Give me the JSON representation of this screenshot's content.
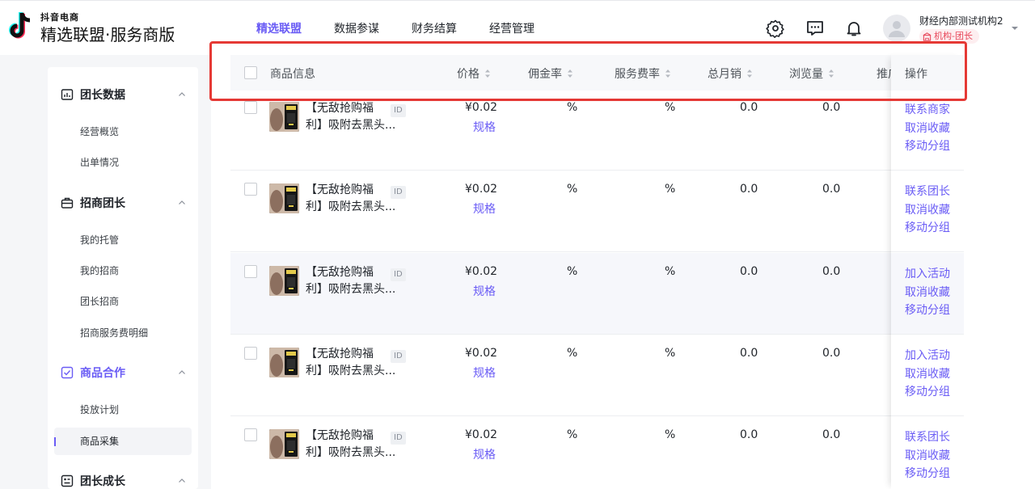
{
  "brand": {
    "small": "抖音电商",
    "main": "精选联盟·服务商版"
  },
  "nav": {
    "items": [
      "精选联盟",
      "数据参谋",
      "财务结算",
      "经营管理"
    ],
    "active_index": 0
  },
  "account": {
    "name": "财经内部测试机构2",
    "role": "机构-团长"
  },
  "sidebar": {
    "sections": [
      {
        "title": "团长数据",
        "icon": "chart-icon",
        "items": [
          "经营概览",
          "出单情况"
        ]
      },
      {
        "title": "招商团长",
        "icon": "briefcase-icon",
        "items": [
          "我的托管",
          "我的招商",
          "团长招商",
          "招商服务费明细"
        ]
      },
      {
        "title": "商品合作",
        "icon": "checkbox-icon",
        "items": [
          "投放计划",
          "商品采集"
        ]
      },
      {
        "title": "团长成长",
        "icon": "growth-icon",
        "items": []
      }
    ],
    "active_section": "商品合作",
    "active_item": "商品采集"
  },
  "table": {
    "columns": [
      "商品信息",
      "价格",
      "佣金率",
      "服务费率",
      "总月销",
      "浏览量",
      "推广",
      "操作"
    ],
    "rows": [
      {
        "title_line1": "【无敌抢购福",
        "title_line2": "利】吸附去黑头...",
        "id_tag": "ID",
        "price": "¥0.02",
        "spec": "规格",
        "commission": "%",
        "service_fee": "%",
        "monthly_sales": "0.0",
        "views": "0.0",
        "ops": [
          "联系商家",
          "取消收藏",
          "移动分组"
        ]
      },
      {
        "title_line1": "【无敌抢购福",
        "title_line2": "利】吸附去黑头...",
        "id_tag": "ID",
        "price": "¥0.02",
        "spec": "规格",
        "commission": "%",
        "service_fee": "%",
        "monthly_sales": "0.0",
        "views": "0.0",
        "ops": [
          "联系团长",
          "取消收藏",
          "移动分组"
        ]
      },
      {
        "title_line1": "【无敌抢购福",
        "title_line2": "利】吸附去黑头...",
        "id_tag": "ID",
        "price": "¥0.02",
        "spec": "规格",
        "commission": "%",
        "service_fee": "%",
        "monthly_sales": "0.0",
        "views": "0.0",
        "ops": [
          "加入活动",
          "取消收藏",
          "移动分组"
        ]
      },
      {
        "title_line1": "【无敌抢购福",
        "title_line2": "利】吸附去黑头...",
        "id_tag": "ID",
        "price": "¥0.02",
        "spec": "规格",
        "commission": "%",
        "service_fee": "%",
        "monthly_sales": "0.0",
        "views": "0.0",
        "ops": [
          "加入活动",
          "取消收藏",
          "移动分组"
        ]
      },
      {
        "title_line1": "【无敌抢购福",
        "title_line2": "利】吸附去黑头...",
        "id_tag": "ID",
        "price": "¥0.02",
        "spec": "规格",
        "commission": "%",
        "service_fee": "%",
        "monthly_sales": "0.0",
        "views": "0.0",
        "ops": [
          "联系团长",
          "取消收藏",
          "移动分组"
        ]
      }
    ]
  },
  "colors": {
    "accent": "#6a5cf5",
    "highlight_box": "#e53935",
    "role_badge_text": "#e8475a"
  }
}
